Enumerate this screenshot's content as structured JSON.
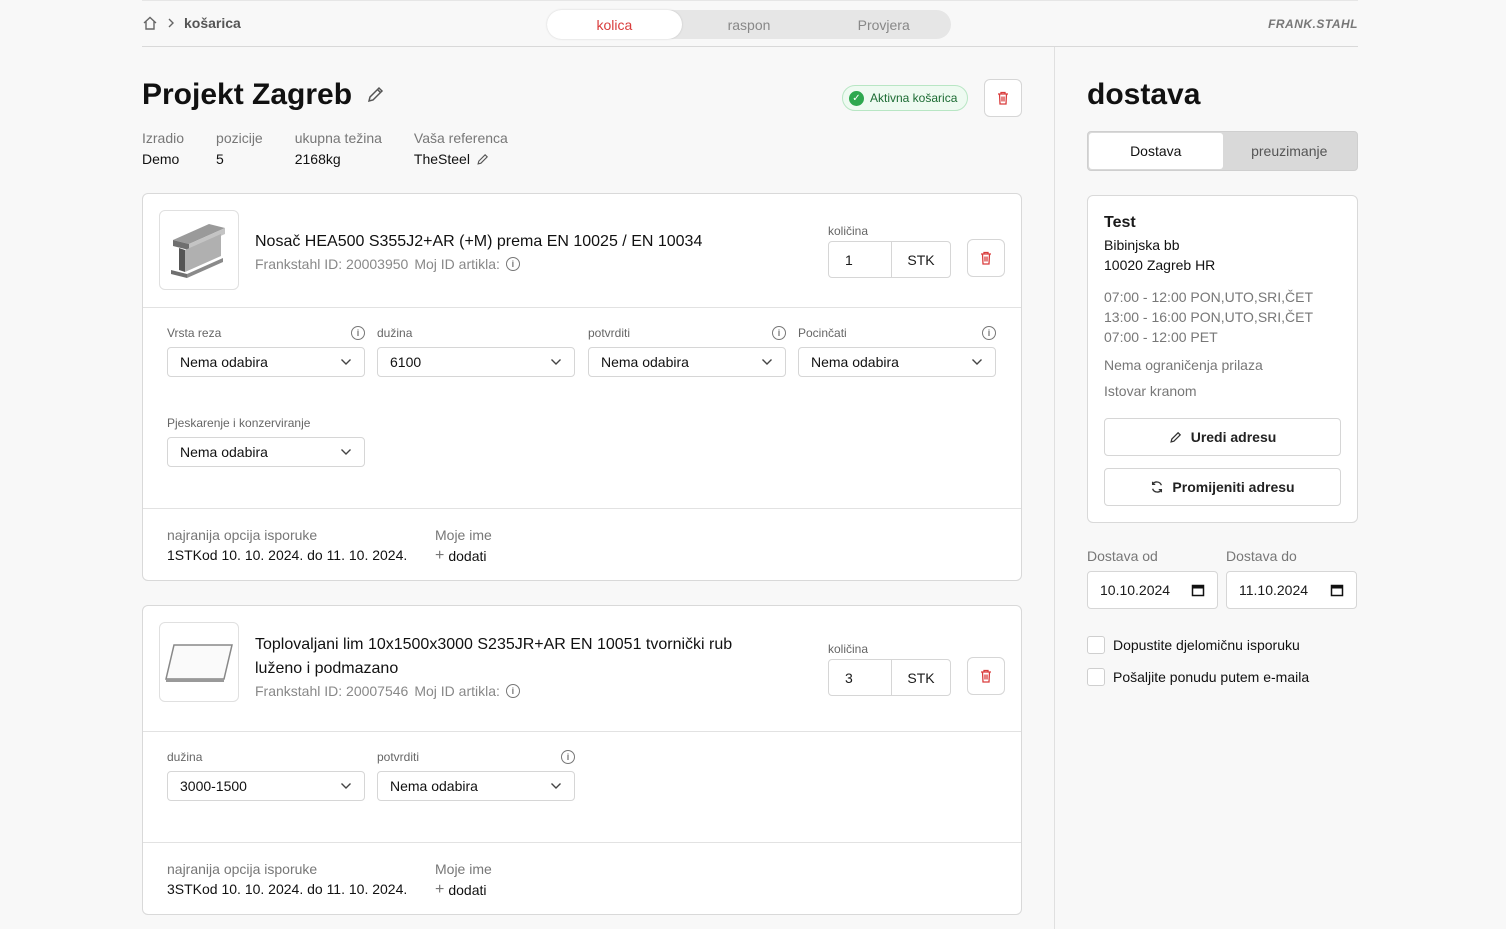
{
  "breadcrumb": {
    "current": "košarica"
  },
  "steps": [
    "kolica",
    "raspon",
    "Provjera"
  ],
  "brand": "FRANK.STAHL",
  "project": {
    "title": "Projekt Zagreb",
    "status": "Aktivna košarica",
    "meta": [
      {
        "label": "Izradio",
        "value": "Demo"
      },
      {
        "label": "pozicije",
        "value": "5"
      },
      {
        "label": "ukupna težina",
        "value": "2168kg"
      },
      {
        "label": "Vaša referenca",
        "value": "TheSteel"
      }
    ]
  },
  "products": [
    {
      "title": "Nosač HEA500 S355J2+AR (+M) prema EN 10025 / EN 10034",
      "id_text": "Frankstahl ID: 20003950",
      "my_id_label": "Moj ID artikla:",
      "qty_label": "količina",
      "qty": "1",
      "unit": "STK",
      "options": [
        {
          "label": "Vrsta reza",
          "value": "Nema odabira",
          "info": true
        },
        {
          "label": "dužina",
          "value": "6100",
          "info": false
        },
        {
          "label": "potvrditi",
          "value": "Nema odabira",
          "info": true
        },
        {
          "label": "Pocinčati",
          "value": "Nema odabira",
          "info": true
        },
        {
          "label": "Pjeskarenje i konzerviranje",
          "value": "Nema odabira",
          "info": false
        }
      ],
      "delivery_label": "najranija opcija isporuke",
      "delivery_value": "1STKod 10. 10. 2024. do 11. 10. 2024.",
      "name_label": "Moje ime",
      "name_add": "dodati"
    },
    {
      "title": "Toplovaljani lim 10x1500x3000 S235JR+AR EN 10051 tvornički rub luženo i podmazano",
      "id_text": "Frankstahl ID: 20007546",
      "my_id_label": "Moj ID artikla:",
      "qty_label": "količina",
      "qty": "3",
      "unit": "STK",
      "options": [
        {
          "label": "dužina",
          "value": "3000-1500",
          "info": false
        },
        {
          "label": "potvrditi",
          "value": "Nema odabira",
          "info": true
        }
      ],
      "delivery_label": "najranija opcija isporuke",
      "delivery_value": "3STKod 10. 10. 2024. do 11. 10. 2024.",
      "name_label": "Moje ime",
      "name_add": "dodati"
    }
  ],
  "side": {
    "title": "dostava",
    "tabs": [
      "Dostava",
      "preuzimanje"
    ],
    "address": {
      "name": "Test",
      "street": "Bibinjska bb",
      "city": "10020 Zagreb HR",
      "hours": [
        "07:00 - 12:00 PON,UTO,SRI,ČET",
        "13:00 - 16:00 PON,UTO,SRI,ČET",
        "07:00 - 12:00 PET"
      ],
      "note1": "Nema ograničenja prilaza",
      "note2": "Istovar kranom",
      "edit": "Uredi adresu",
      "change": "Promijeniti adresu"
    },
    "date_from_label": "Dostava od",
    "date_from": "10.10.2024",
    "date_to_label": "Dostava do",
    "date_to": "11.10.2024",
    "check1": "Dopustite djelomičnu isporuku",
    "check2": "Pošaljite ponudu putem e-maila"
  }
}
